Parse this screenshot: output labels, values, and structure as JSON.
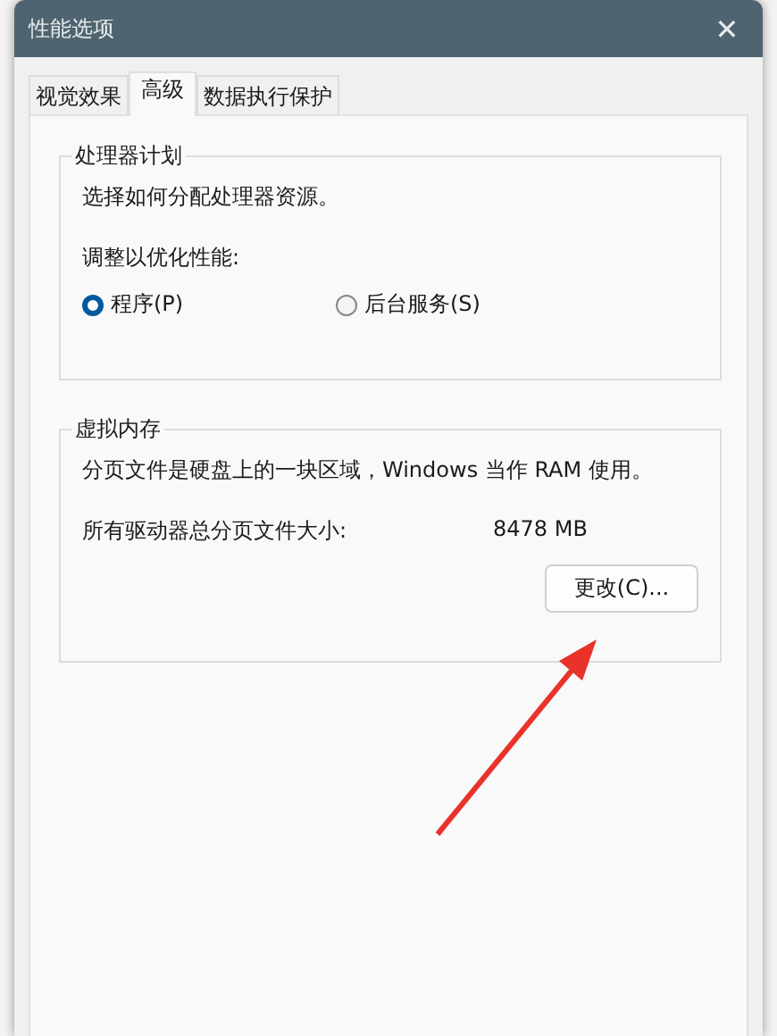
{
  "window": {
    "title": "性能选项",
    "close": "✕"
  },
  "tabs": [
    {
      "label": "视觉效果",
      "selected": false
    },
    {
      "label": "高级",
      "selected": true
    },
    {
      "label": "数据执行保护",
      "selected": false
    }
  ],
  "processor_group": {
    "title": "处理器计划",
    "description": "选择如何分配处理器资源。",
    "prompt": "调整以优化性能:",
    "options": [
      {
        "label": "程序(P)",
        "selected": true
      },
      {
        "label": "后台服务(S)",
        "selected": false
      }
    ]
  },
  "memory_group": {
    "title": "虚拟内存",
    "description": "分页文件是硬盘上的一块区域，Windows 当作 RAM 使用。",
    "size_label": "所有驱动器总分页文件大小:",
    "size_value": "8478 MB",
    "button": "更改(C)..."
  }
}
